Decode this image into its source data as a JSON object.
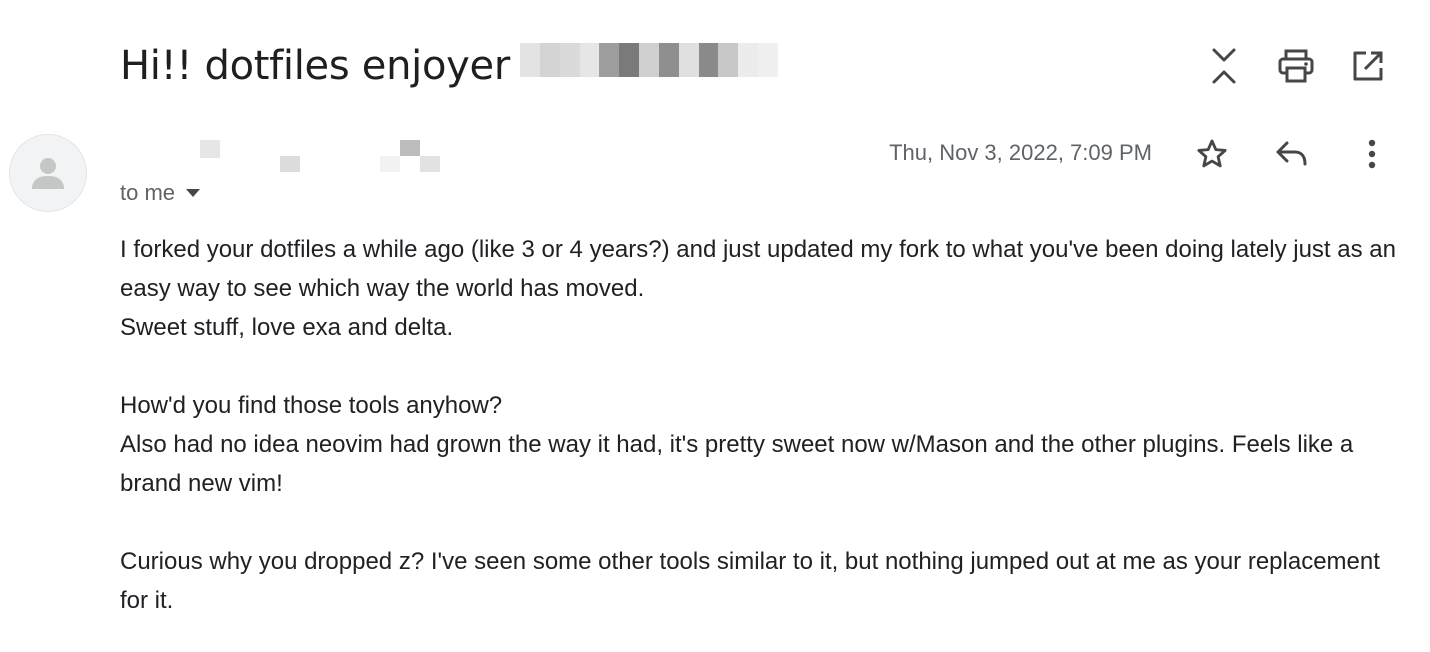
{
  "email": {
    "subject": "Hi!! dotfiles enjoyer",
    "recipient_label": "to me",
    "date": "Thu, Nov 3, 2022, 7:09 PM",
    "paragraphs": [
      [
        "I forked your dotfiles a while ago (like 3 or 4 years?) and just updated my fork to what you've been doing lately just as an easy way to see which way the world has moved.",
        "Sweet stuff, love exa and delta."
      ],
      [
        "How'd you find those tools anyhow?",
        "Also had no idea neovim had grown the way it had, it's pretty sweet now w/Mason and the other plugins. Feels like a brand new vim!"
      ],
      [
        "Curious why you dropped z? I've seen some other tools similar to it, but nothing jumped out at me as your replacement for it."
      ]
    ]
  },
  "icons": {
    "collapse": "collapse-all-icon",
    "print": "print-icon",
    "open_new_window": "open-in-new-window-icon",
    "star": "star-icon",
    "reply": "reply-icon",
    "more": "more-vertical-icon",
    "dropdown": "caret-down-icon",
    "avatar": "default-avatar-icon"
  },
  "colors": {
    "text_primary": "#202124",
    "text_secondary": "#5f6368",
    "icon": "#444746",
    "avatar_bg": "#f1f3f4"
  }
}
